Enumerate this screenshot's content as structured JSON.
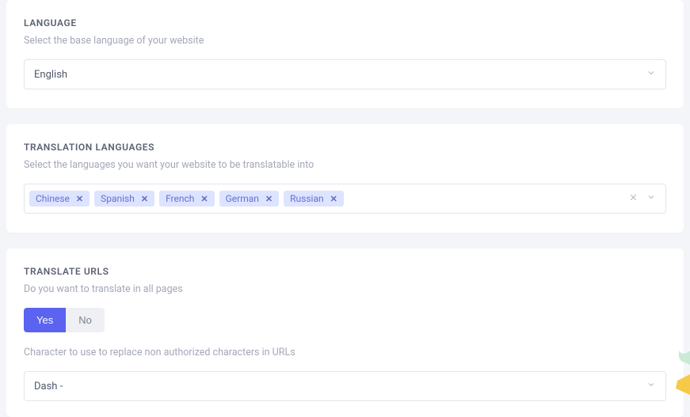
{
  "language": {
    "title": "LANGUAGE",
    "help": "Select the base language of your website",
    "selected": "English"
  },
  "translation": {
    "title": "TRANSLATION LANGUAGES",
    "help": "Select the languages you want your website to be translatable into",
    "tags": [
      "Chinese",
      "Spanish",
      "French",
      "German",
      "Russian"
    ]
  },
  "urls": {
    "title": "TRANSLATE URLS",
    "help1": "Do you want to translate in all pages",
    "yes": "Yes",
    "no": "No",
    "help2": "Character to use to replace non authorized characters in URLs",
    "selected": "Dash -"
  }
}
